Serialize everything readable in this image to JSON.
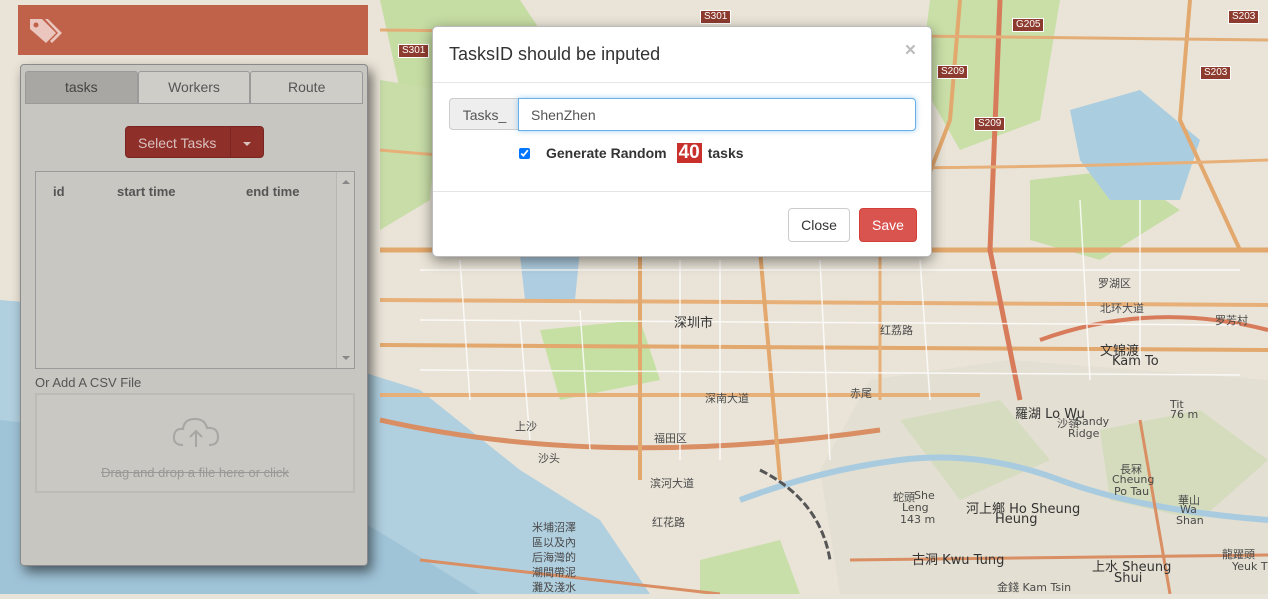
{
  "map": {
    "city_label": "深圳市",
    "labels": [
      "罗湖区",
      "福田区",
      "上沙",
      "沙头",
      "赤尾",
      "红花路",
      "罗芳村",
      "文锦渡",
      "Kam To",
      "羅湖 Lo Wu",
      "沙嶺",
      "Sandy",
      "Ridge",
      "Tit",
      "76 m",
      "長冧",
      "Cheung",
      "Po Tau",
      "華山",
      "Wa",
      "Shan",
      "蛇頭",
      "She",
      "Leng",
      "143 m",
      "河上鄉 Ho Sheung",
      "Heung",
      "古洞 Kwu Tung",
      "金錢 Kam Tsin",
      "上水 Sheung",
      "Shui",
      "龍躍頭",
      "Yeuk T",
      "米埔沼澤",
      "區以及內",
      "后海灣的",
      "潮間帶泥",
      "灘及淺水",
      "红荔路",
      "深南大道",
      "滨河大道",
      "北环大道"
    ],
    "route_shields": [
      "S301",
      "S301",
      "S209",
      "G205",
      "S203",
      "S209",
      "S203"
    ]
  },
  "panel": {
    "tabs": [
      {
        "label": "tasks",
        "active": true
      },
      {
        "label": "Workers",
        "active": false
      },
      {
        "label": "Route",
        "active": false
      }
    ],
    "select_tasks_label": "Select Tasks",
    "table": {
      "columns": [
        "id",
        "start time",
        "end time"
      ],
      "rows": []
    },
    "csv_label": "Or Add A CSV File",
    "dropzone_text": "Drag and drop a file here or click"
  },
  "modal": {
    "title": "TasksID should be inputed",
    "close_x": "×",
    "addon": "Tasks_",
    "input_value": "ShenZhen",
    "generate_label": "Generate Random",
    "generate_checked": true,
    "random_count": "40",
    "tasks_suffix": "tasks",
    "close_label": "Close",
    "save_label": "Save"
  },
  "colors": {
    "panel_header": "#c0614a",
    "select_button": "#8e2f2a",
    "save_button": "#d9534f",
    "count_badge": "#c9302c",
    "input_focus": "#66afe9"
  },
  "icons": {
    "panel_header": "tag-icon",
    "dropzone": "cloud-upload-icon",
    "select_caret": "caret-down-icon"
  }
}
